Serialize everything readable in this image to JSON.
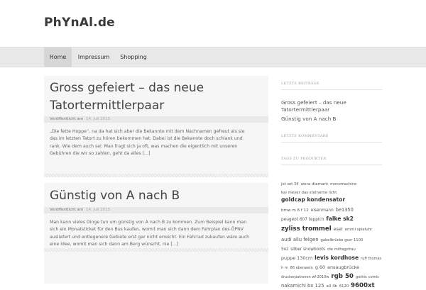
{
  "site": {
    "title": "PhYnAl.de"
  },
  "nav": {
    "items": [
      {
        "label": "Home"
      },
      {
        "label": "Impressum"
      },
      {
        "label": "Shopping"
      }
    ]
  },
  "posts": [
    {
      "title_line1": "Gross gefeiert – das neue",
      "title_line2": "Tatortermittlerpaar",
      "meta_label": "Veröffentlicht am",
      "meta_date": "14. Juli 2015",
      "excerpt": [
        "„Die fette Hoppe“, na da hat sich aber die Bekannte mit dem Nachnamen gefreut als sie",
        "das im letzten Tatort zu hören bekommen hat. Dabei ist die Bekannte doch schlank und",
        "rank. Wie dem auch sei. Man fragt sich ja oft, was machen die eigentlich mit unseren",
        "Gebühren die wir so zahlen, geht da alles […]"
      ]
    },
    {
      "title_line1": "Günstig von A nach B",
      "meta_label": "Veröffentlicht am",
      "meta_date": "14. Juli 2015",
      "excerpt": [
        "Man kann vieles Dinge tun um günstig von A nach B zu kommen. Zum Beispiel kann man",
        "sich ein Monatsticket für den Bus kaufen, womit man sich dann dem Fahrplan des ÖPNV",
        "ausliefert und entlegenere Gebiete erst gar nicht erreicht. Ein Fahrrad zukaufen wäre auch",
        "eine Idee, womit man sich dann am Berg wünscht, nie […]"
      ]
    }
  ],
  "sidebar": {
    "recent_title": "Letzte Beiträge",
    "recent": [
      "Gross gefeiert – das neue",
      "Tatortermittlerpaar",
      "Günstig von A nach B"
    ],
    "comments_title": "Letzte Kommentare",
    "tags_title": "Tags zu Produkten",
    "tag_lines": [
      [
        {
          "t": "jet set 34",
          "s": 5.2
        },
        {
          "t": "wera diamant",
          "s": 5.6
        },
        {
          "t": "monomachine",
          "s": 5.2
        }
      ],
      [
        {
          "t": "kai meyer das steinerne licht",
          "s": 5.4
        }
      ],
      [
        {
          "t": "goldcap kondensator",
          "s": 7.6,
          "b": true
        }
      ],
      [
        {
          "t": "bmw m 6 f 12",
          "s": 5.6
        },
        {
          "t": "eisenmann",
          "s": 5.8
        },
        {
          "t": "be1350",
          "s": 6.6
        }
      ],
      [
        {
          "t": "peugeot 607 teppich",
          "s": 5.8
        },
        {
          "t": "falke sk2",
          "s": 7.6,
          "b": true
        }
      ],
      [
        {
          "t": "zyliss trommel",
          "s": 8.6,
          "b": true
        },
        {
          "t": "esel",
          "s": 6.4
        },
        {
          "t": "emmi spieluhr",
          "s": 5.4
        }
      ],
      [
        {
          "t": "audi allu felgen",
          "s": 6.8
        },
        {
          "t": "gabelbrücke gsxr 1100",
          "s": 5.2
        }
      ],
      [
        {
          "t": "5oz",
          "s": 5.8
        },
        {
          "t": "silber snowboots",
          "s": 5.8
        },
        {
          "t": "die mittagsfrau",
          "s": 5.2
        }
      ],
      [
        {
          "t": "puppe 130cm",
          "s": 6.4
        },
        {
          "t": "levis kordhose",
          "s": 7.6,
          "b": true
        },
        {
          "t": "ruff thomas",
          "s": 5.0
        }
      ],
      [
        {
          "t": "h m",
          "s": 5.0
        },
        {
          "t": "86 ebenwein",
          "s": 5.0
        },
        {
          "t": "g 60",
          "s": 6.4
        },
        {
          "t": "ansaugbrücke",
          "s": 6.4
        }
      ],
      [
        {
          "t": "druckerpatronen wf-2010w",
          "s": 5.0
        },
        {
          "t": "rgb 50",
          "s": 8.6,
          "b": true
        },
        {
          "t": "gothic comic",
          "s": 5.2
        }
      ],
      [
        {
          "t": "nakamichi bx 125",
          "s": 6.8
        },
        {
          "t": "a4 4b",
          "s": 5.4
        },
        {
          "t": "6120",
          "s": 5.2
        },
        {
          "t": "9600xt",
          "s": 8.6,
          "b": true
        }
      ]
    ]
  },
  "colors": {
    "nav_bg": "#e8e8e8",
    "post_bg": "#f6f6f6",
    "title": "#444444"
  }
}
